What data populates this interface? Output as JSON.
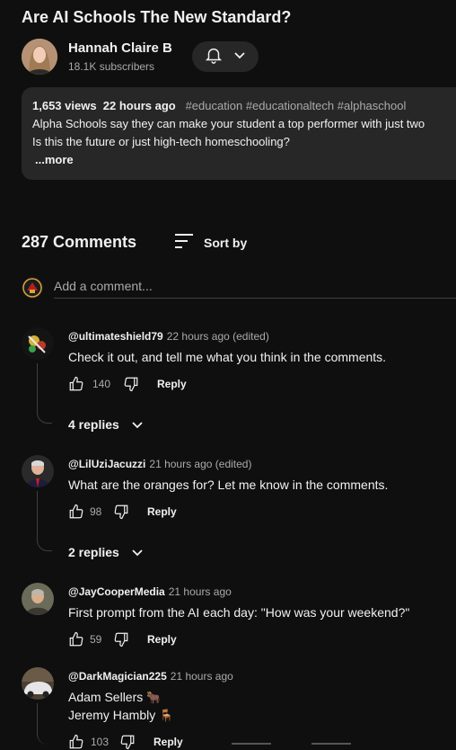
{
  "video": {
    "title": "Are AI Schools The New Standard?",
    "channel_name": "Hannah Claire B",
    "subscribers": "18.1K subscribers"
  },
  "description": {
    "views": "1,653 views",
    "age": "22 hours ago",
    "tags": [
      "#education",
      "#educationaltech",
      "#alphaschool"
    ],
    "line1": "Alpha Schools say they can make your student a top performer with just two",
    "line2": "Is this the future or just high-tech homeschooling?",
    "more": "...more"
  },
  "comments_header": {
    "count": "287 Comments",
    "sort_label": "Sort by"
  },
  "add_comment": {
    "placeholder": "Add a comment..."
  },
  "comments": [
    {
      "author": "@ultimateshield79",
      "time": "22 hours ago (edited)",
      "text": "Check it out, and tell me what you think in the comments.",
      "likes": "140",
      "reply_label": "Reply",
      "replies": "4 replies"
    },
    {
      "author": "@LilUziJacuzzi",
      "time": "21 hours ago (edited)",
      "text": "What are the oranges for? Let me know in the comments.",
      "likes": "98",
      "reply_label": "Reply",
      "replies": "2 replies"
    },
    {
      "author": "@JayCooperMedia",
      "time": "21 hours ago",
      "text": "First prompt from the AI each day: \"How was your weekend?\"",
      "likes": "59",
      "reply_label": "Reply"
    },
    {
      "author": "@DarkMagician225",
      "time": "21 hours ago",
      "text_line1": "Adam Sellers",
      "emoji1": "🐂",
      "text_line2": "Jeremy Hambly",
      "emoji2": "🪑",
      "likes": "103",
      "reply_label": "Reply"
    }
  ],
  "colors": {
    "background": "#0f0f0f",
    "surface": "#272727",
    "text": "#f1f1f1",
    "secondary_text": "#aaaaaa"
  }
}
